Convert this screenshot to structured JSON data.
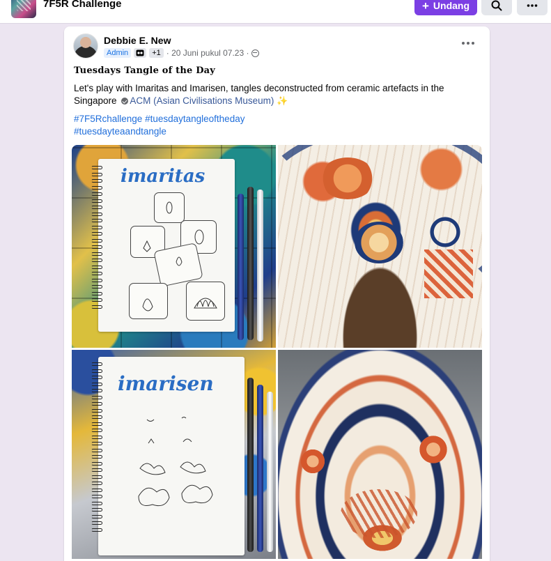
{
  "topbar": {
    "group_name": "7F5R Challenge",
    "invite_label": "Undang",
    "search_icon": "search-icon",
    "more_icon": "more-icon"
  },
  "post": {
    "author": "Debbie E. New",
    "badge_admin": "Admin",
    "badge_plus": "+1",
    "timestamp": "· 20 Juni pukul 07.23 ·",
    "title": "Tuesdays Tangle of the Day",
    "body_text": "Let's play with Imaritas and Imarisen, tangles deconstructed from ceramic artefacts in the Singapore",
    "mention": "ACM (Asian Civilisations Museum)",
    "hashtags": [
      "#7F5Rchallenge",
      "#tuesdaytangleoftheday",
      "#tuesdayteaandtangle"
    ],
    "photos": [
      {
        "handwritten_title": "imaritas"
      },
      {},
      {
        "handwritten_title": "imarisen"
      },
      {}
    ]
  },
  "colors": {
    "accent": "#7b3fe4",
    "link": "#216fdb",
    "page_bg": "#ece5f1"
  }
}
